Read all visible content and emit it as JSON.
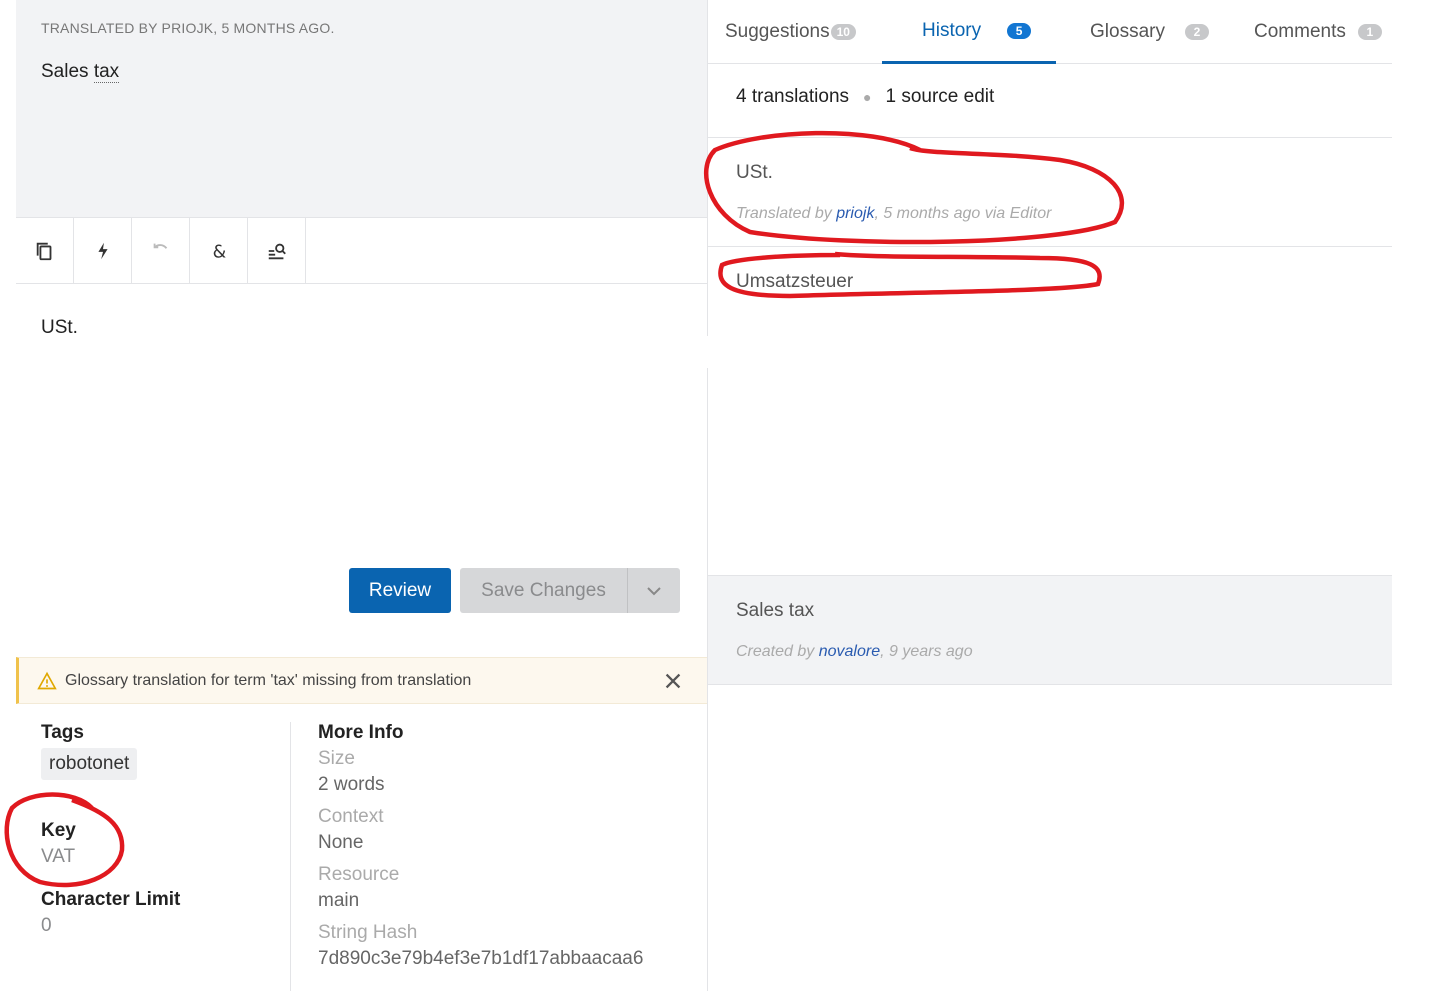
{
  "source": {
    "meta": "TRANSLATED BY PRIOJK, 5 MONTHS AGO.",
    "text_prefix": "Sales ",
    "text_term": "tax"
  },
  "toolbar": {
    "icons": [
      "copy-icon",
      "bolt-icon",
      "undo-icon",
      "ampersand-icon",
      "search-list-icon"
    ]
  },
  "translation": {
    "text": "USt."
  },
  "actions": {
    "review_label": "Review",
    "save_label": "Save Changes"
  },
  "warning": {
    "text": "Glossary translation for term 'tax' missing from translation"
  },
  "details": {
    "tags_label": "Tags",
    "tag": "robotonet",
    "key_label": "Key",
    "key_value": "VAT",
    "char_limit_label": "Character Limit",
    "char_limit_value": "0",
    "more_info_label": "More Info",
    "size_label": "Size",
    "size_value": "2 words",
    "context_label": "Context",
    "context_value": "None",
    "resource_label": "Resource",
    "resource_value": "main",
    "hash_label": "String Hash",
    "hash_value": "7d890c3e79b4ef3e7b1df17abbaacaa6"
  },
  "tabs": [
    {
      "label": "Suggestions",
      "badge": "10"
    },
    {
      "label": "History",
      "badge": "5"
    },
    {
      "label": "Glossary",
      "badge": "2"
    },
    {
      "label": "Comments",
      "badge": "1"
    }
  ],
  "history": {
    "translations_count": "4 translations",
    "source_edits": "1 source edit",
    "items": [
      {
        "text": "USt.",
        "meta_prefix": "Translated by ",
        "user": "priojk",
        "meta_suffix": ", 5 months ago via Editor"
      },
      {
        "text": "Umsatzsteuer"
      }
    ],
    "created": {
      "text": "Sales tax",
      "meta_prefix": "Created by ",
      "user": "novalore",
      "meta_suffix": ", 9 years ago"
    }
  },
  "colors": {
    "accent": "#0a64b0",
    "annotation": "#e0191f",
    "warning": "#f0c24b"
  }
}
